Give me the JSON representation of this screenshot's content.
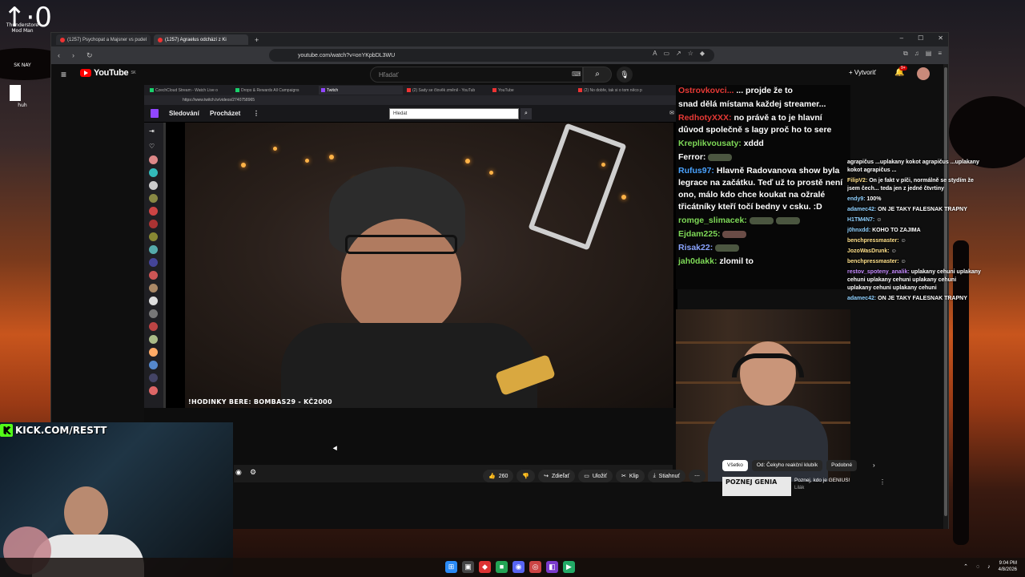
{
  "desktop": {
    "counter": "↑·0",
    "icons": [
      {
        "label": "Thunderstore Mod Man"
      },
      {
        "label": "SK NAY"
      },
      {
        "label": "huh"
      }
    ]
  },
  "browser": {
    "tabs": [
      {
        "label": "(1257) Psychopat a Majsner vs pudel"
      },
      {
        "label": "(1257) Agraelus odchází z Ki"
      }
    ],
    "new_tab": "+",
    "url": "youtube.com/watch?v=onYKpbDL3WU",
    "window_controls": [
      "–",
      "☐",
      "✕"
    ]
  },
  "youtube": {
    "logo": "YouTube",
    "logo_region": "SK",
    "search_placeholder": "Hľadať",
    "create_label": "Vytvoriť",
    "notif_badge": "9+",
    "actions": {
      "likes": "260",
      "share": "Zdieľať",
      "save": "Uložiť",
      "clip": "Klip",
      "download": "Stiahnuť"
    },
    "chips": [
      "Všetko",
      "Od: Čekyho reakční klubík",
      "Podobné"
    ],
    "recommended": {
      "thumb_text": "POZNEJ GENIA",
      "title": "Poznej, kdo je GENIUS!",
      "channel": "Lilák"
    }
  },
  "inner_browser": {
    "tabs": [
      "CzechCloud Stream - Watch Live o",
      "Drops & Rewards All Campaigns",
      "Twitch",
      "(2) Sady se člověk změnil - YouTub",
      "YouTube",
      "(2) No dobře, tak si o tom něco p"
    ],
    "url": "https://www.twitch.tv/videos/2740758965"
  },
  "twitch": {
    "nav_following": "Sledování",
    "nav_browse": "Procházet",
    "search_placeholder": "Hledat",
    "overlay": "!HODINKY BERE: BOMBAS29 - KČ2000"
  },
  "chat_main": [
    {
      "user": "Ostrovkovci...",
      "text": "... projde že to",
      "color": "#e53935"
    },
    {
      "user": "",
      "text": "snad dělá místama každej streamer...",
      "color": "#ffffff"
    },
    {
      "user": "RedhotyXXX:",
      "text": "no právě a to je hlavní důvod společně s lagy proč ho to sere",
      "color": "#e53935"
    },
    {
      "user": "Kreplikvousaty:",
      "text": "xddd",
      "color": "#7ed957"
    },
    {
      "user": "Ferror:",
      "text": "",
      "color": "#ffffff"
    },
    {
      "user": "Rufus97:",
      "text": "Hlavně Radovanova show byla legrace na začátku. Teď už to prostě není ono, málo kdo chce koukat na ožralé třicátníky kteří točí bedny v csku. :D",
      "color": "#4aa3ff"
    },
    {
      "user": "romge_slimacek:",
      "text": "",
      "color": "#7ed957"
    },
    {
      "user": "Ejdam225:",
      "text": "",
      "color": "#7ed957"
    },
    {
      "user": "Risak22:",
      "text": "",
      "color": "#8aa4ff"
    },
    {
      "user": "jah0dakk:",
      "text": "zlomil to",
      "color": "#7ed957"
    }
  ],
  "chat_side": [
    {
      "user": "",
      "text": "agrapičus ...uplakany kokot agrapičus ...uplakany kokot agrapičus ..."
    },
    {
      "user": "FilipV2:",
      "text": "On je fakt v píči, normálně se stydím že jsem čech... teda jen z jedné čtvrtiny"
    },
    {
      "user": "endy9:",
      "text": "100%"
    },
    {
      "user": "adamec42:",
      "text": "ON JE TAKY FALESNAK TRAPNY"
    },
    {
      "user": "H1TM4N7:",
      "text": ""
    },
    {
      "user": "j0hnxdd:",
      "text": "KOHO TO ZAJIMA"
    },
    {
      "user": "benchpressmaster:",
      "text": ""
    },
    {
      "user": "JozoWasDrunk:",
      "text": ""
    },
    {
      "user": "benchpressmaster:",
      "text": ""
    },
    {
      "user": "restov_spoteny_analik:",
      "text": "uplakany cehuni uplakany cehuni uplakany cehuni uplakany cehuni uplakany cehuni uplakany cehuni"
    },
    {
      "user": "adamec42:",
      "text": "ON JE TAKY FALESNAK TRAPNY"
    }
  ],
  "kick_banner": "KICK.COM/RESTT",
  "taskbar": {
    "time": "9:04 PM",
    "date": "4/8/2026"
  },
  "colors": {
    "youtube_red": "#ff0000",
    "twitch_purple": "#9146ff",
    "kick_green": "#53fc18"
  }
}
